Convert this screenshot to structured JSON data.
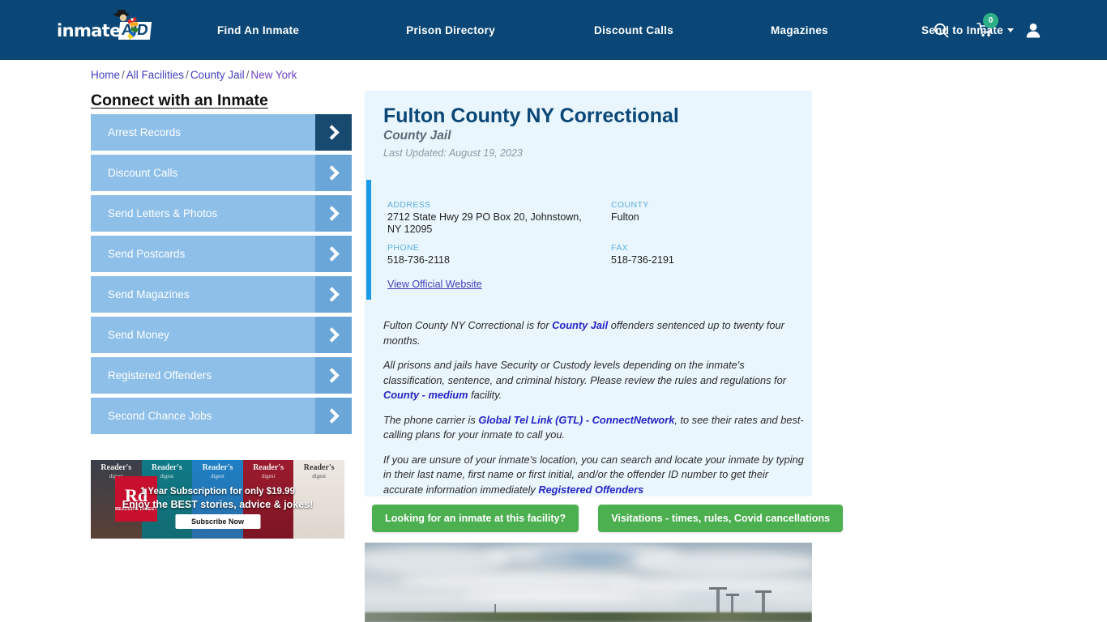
{
  "header": {
    "logo": {
      "text": "inmate",
      "badge": "AID",
      "mascot_icon": "mascot-icon"
    },
    "nav": [
      {
        "label": "Find An Inmate",
        "name": "nav-find-an-inmate"
      },
      {
        "label": "Prison Directory",
        "name": "nav-prison-directory"
      },
      {
        "label": "Discount Calls",
        "name": "nav-discount-calls"
      },
      {
        "label": "Magazines",
        "name": "nav-magazines"
      },
      {
        "label": "Send to Inmate",
        "name": "nav-send-to-inmate",
        "has_dropdown": true
      }
    ],
    "icons": {
      "search": "search-icon",
      "cart": "shopping-cart-icon",
      "cart_count": "0",
      "account": "user-account-icon"
    },
    "colors": {
      "background": "#0a4777",
      "cart_badge": "#2eb086"
    }
  },
  "breadcrumb": {
    "items": [
      {
        "label": "Home",
        "visited": false
      },
      {
        "label": "All Facilities",
        "visited": false
      },
      {
        "label": "County Jail",
        "visited": false
      },
      {
        "label": "New York",
        "visited": true
      }
    ],
    "separator": "/"
  },
  "sidebar": {
    "title": "Connect with an Inmate",
    "items": [
      {
        "label": "Arrest Records",
        "active": true
      },
      {
        "label": "Discount Calls",
        "active": false
      },
      {
        "label": "Send Letters & Photos",
        "active": false
      },
      {
        "label": "Send Postcards",
        "active": false
      },
      {
        "label": "Send Magazines",
        "active": false
      },
      {
        "label": "Send Money",
        "active": false
      },
      {
        "label": "Registered Offenders",
        "active": false
      },
      {
        "label": "Second Chance Jobs",
        "active": false
      }
    ],
    "colors": {
      "button": "#8dbfe8",
      "arrow_box": "#6ba6d8",
      "arrow_box_active": "#18496f"
    }
  },
  "ad": {
    "brand": "Rd",
    "brand_sub": "READER'S DIGEST",
    "headline": "1 Year Subscription for only $19.99",
    "subhead": "Enjoy the BEST stories, advice & jokes!",
    "cta": "Subscribe Now",
    "covers": [
      {
        "title": "Reader's",
        "sub": "digest"
      },
      {
        "title": "Reader's",
        "sub": "digest"
      },
      {
        "title": "Reader's",
        "sub": "digest"
      },
      {
        "title": "Reader's",
        "sub": "digest"
      },
      {
        "title": "Reader's",
        "sub": "digest"
      }
    ]
  },
  "facility": {
    "name": "Fulton County NY Correctional",
    "type": "County Jail",
    "last_updated": "Last Updated: August 19, 2023",
    "info": {
      "address_label": "ADDRESS",
      "address_value": "2712 State Hwy 29 PO Box 20, Johnstown, NY 12095",
      "county_label": "COUNTY",
      "county_value": "Fulton",
      "phone_label": "PHONE",
      "phone_value": "518-736-2118",
      "fax_label": "FAX",
      "fax_value": "518-736-2191",
      "official_website_link": "View Official Website"
    },
    "description": {
      "p1_a": "Fulton County NY Correctional is for ",
      "p1_link": "County Jail",
      "p1_b": " offenders sentenced up to twenty four months.",
      "p2_a": "All prisons and jails have Security or Custody levels depending on the inmate's classification, sentence, and criminal history. Please review the rules and regulations for ",
      "p2_link": "County - medium",
      "p2_b": " facility.",
      "p3_a": "The phone carrier is ",
      "p3_link": "Global Tel Link (GTL) - ConnectNetwork",
      "p3_b": ", to see their rates and best-calling plans for your inmate to call you.",
      "p4_a": "If you are unsure of your inmate's location, you can search and locate your inmate by typing in their last name, first name or first initial, and/or the offender ID number to get their accurate information immediately ",
      "p4_link": "Registered Offenders"
    },
    "panel_color": "#eaf6fd",
    "accent_color": "#1a9ae8",
    "title_color": "#0a4777"
  },
  "cta_buttons": [
    {
      "label": "Looking for an inmate at this facility?"
    },
    {
      "label": "Visitations - times, rules, Covid cancellations"
    }
  ],
  "cta_color": "#4caf50",
  "facility_photo": {
    "alt": "facility exterior photo with cloudy sky"
  }
}
